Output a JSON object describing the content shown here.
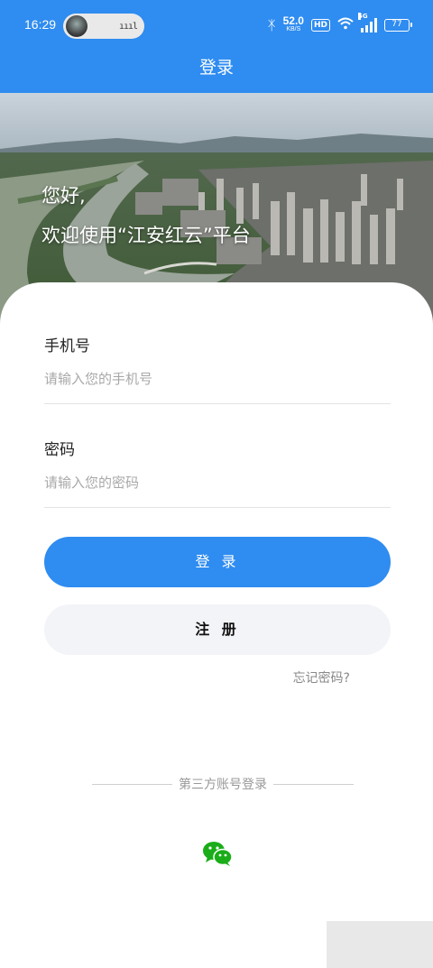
{
  "status_bar": {
    "time": "16:29",
    "pill_indicator": "ıııl",
    "bluetooth_icon": "bluetooth-icon",
    "net_speed_value": "52.0",
    "net_speed_unit": "KB/S",
    "hd_label": "HD",
    "network_label": "5G",
    "battery_level": "77"
  },
  "header": {
    "title": "登录"
  },
  "hero": {
    "greeting_line1": "您好,",
    "greeting_line2": "欢迎使用“江安红云”平台"
  },
  "form": {
    "phone_label": "手机号",
    "phone_placeholder": "请输入您的手机号",
    "password_label": "密码",
    "password_placeholder": "请输入您的密码"
  },
  "actions": {
    "login_label": "登 录",
    "register_label": "注 册",
    "forgot_label": "忘记密码?"
  },
  "third_party": {
    "label": "第三方账号登录",
    "wechat_icon": "wechat-icon"
  },
  "colors": {
    "primary": "#2f8cf0",
    "register_bg": "#f3f4f8",
    "wechat": "#1aad19"
  }
}
